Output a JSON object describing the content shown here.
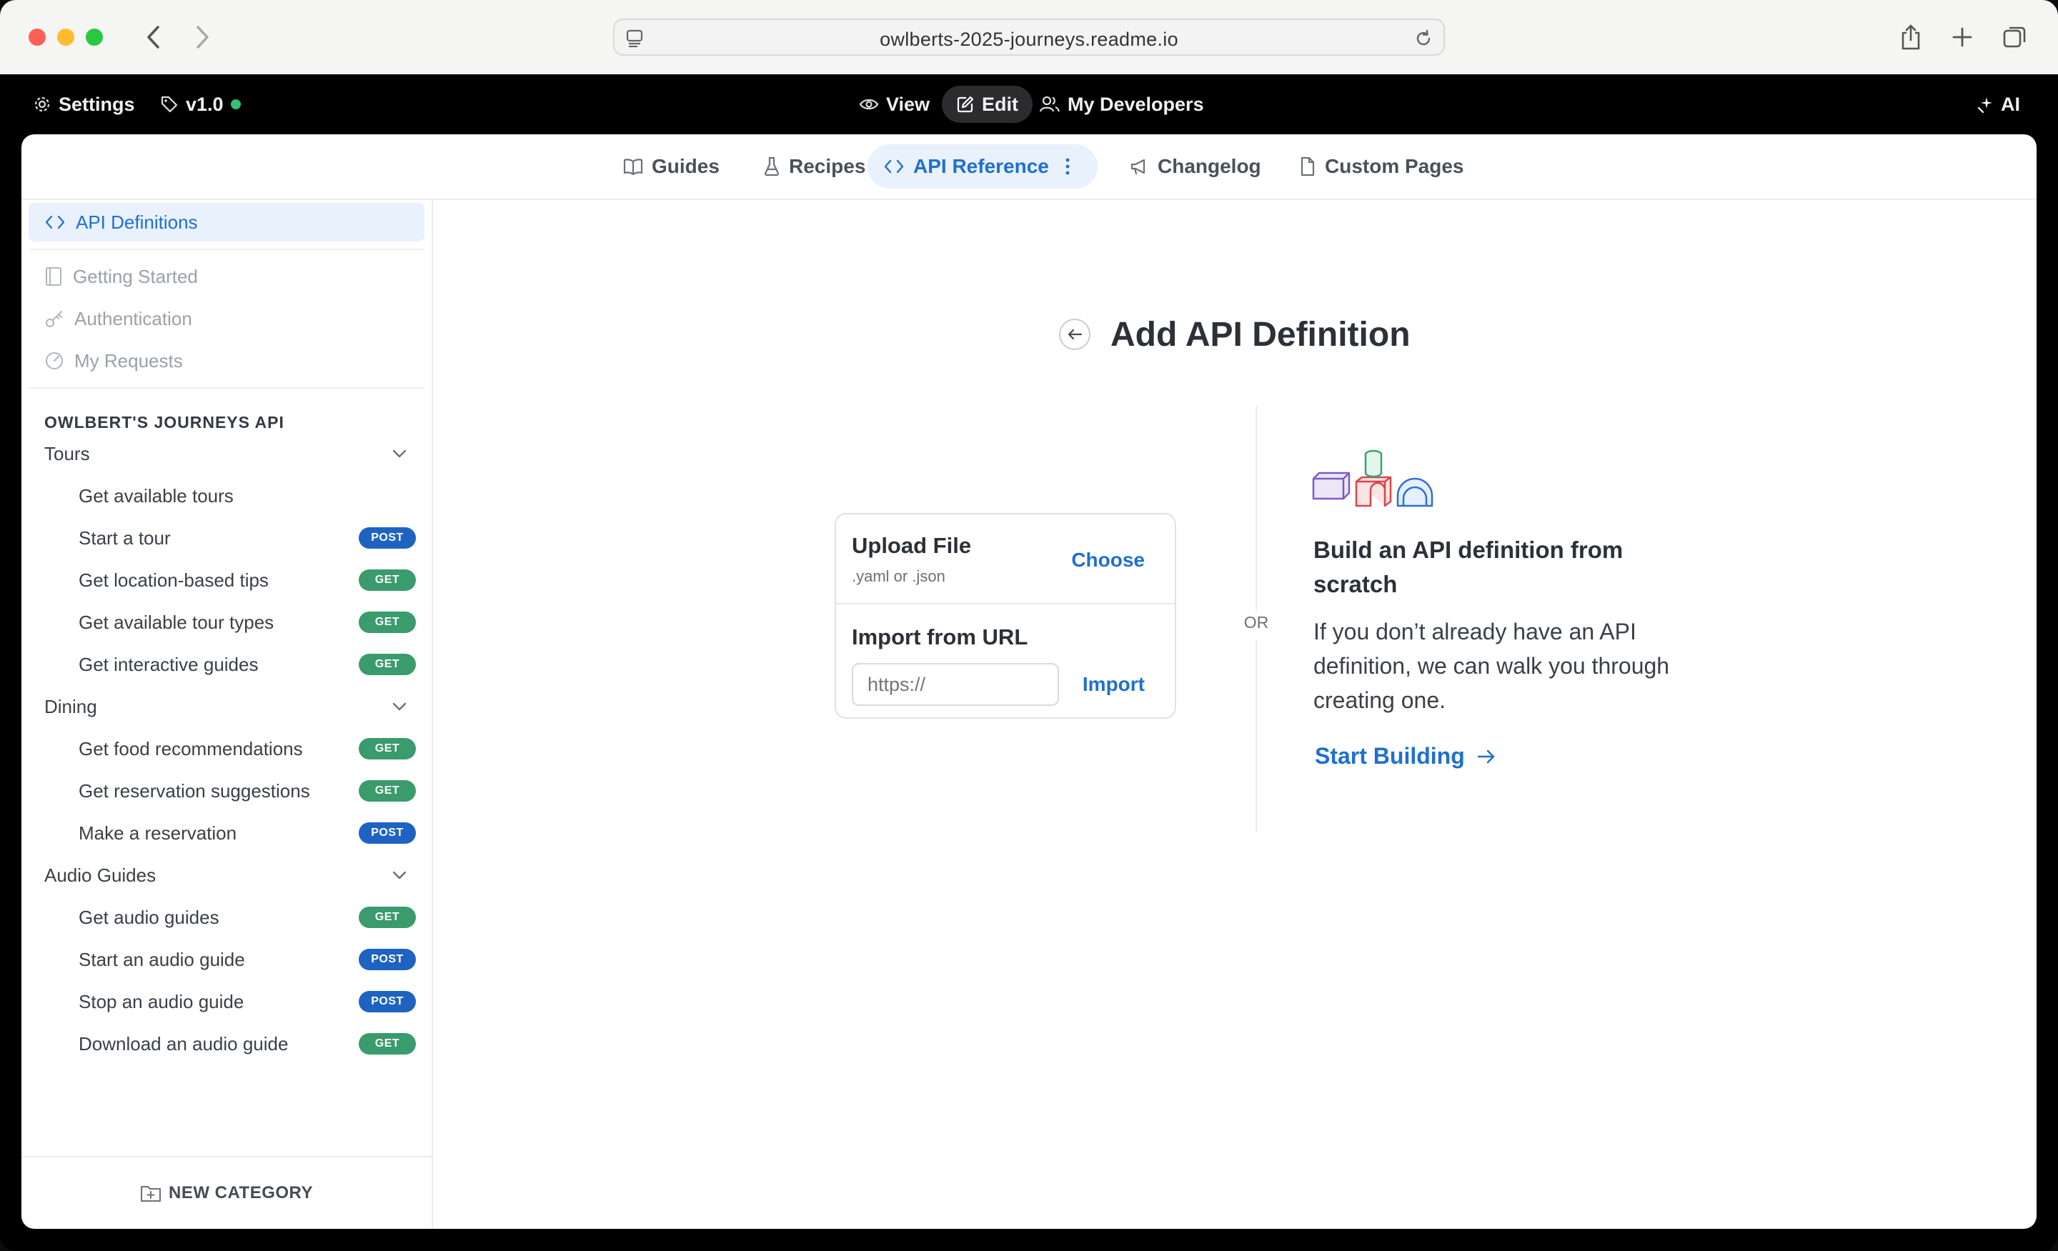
{
  "browser": {
    "url": "owlberts-2025-journeys.readme.io"
  },
  "appbar": {
    "settings_label": "Settings",
    "version_label": "v1.0",
    "view_label": "View",
    "edit_label": "Edit",
    "developers_label": "My Developers",
    "ai_label": "AI"
  },
  "tabs": [
    {
      "label": "Guides",
      "icon": "book-icon"
    },
    {
      "label": "Recipes",
      "icon": "flask-icon"
    },
    {
      "label": "API Reference",
      "icon": "code-icon",
      "active": true
    },
    {
      "label": "Changelog",
      "icon": "megaphone-icon"
    },
    {
      "label": "Custom Pages",
      "icon": "page-icon"
    }
  ],
  "sidebar": {
    "top_items": [
      {
        "label": "API Definitions",
        "icon": "code-icon",
        "active": true
      },
      {
        "label": "Getting Started",
        "icon": "book-icon"
      },
      {
        "label": "Authentication",
        "icon": "key-icon"
      },
      {
        "label": "My Requests",
        "icon": "gauge-icon"
      }
    ],
    "section_heading": "OWLBERT'S JOURNEYS API",
    "categories": [
      {
        "name": "Tours",
        "items": [
          {
            "label": "Get available tours",
            "method": ""
          },
          {
            "label": "Start a tour",
            "method": "POST"
          },
          {
            "label": "Get location-based tips",
            "method": "GET"
          },
          {
            "label": "Get available tour types",
            "method": "GET"
          },
          {
            "label": "Get interactive guides",
            "method": "GET"
          }
        ]
      },
      {
        "name": "Dining",
        "items": [
          {
            "label": "Get food recommendations",
            "method": "GET"
          },
          {
            "label": "Get reservation suggestions",
            "method": "GET"
          },
          {
            "label": "Make a reservation",
            "method": "POST"
          }
        ]
      },
      {
        "name": "Audio Guides",
        "items": [
          {
            "label": "Get audio guides",
            "method": "GET"
          },
          {
            "label": "Start an audio guide",
            "method": "POST"
          },
          {
            "label": "Stop an audio guide",
            "method": "POST"
          },
          {
            "label": "Download an audio guide",
            "method": "GET"
          }
        ]
      }
    ],
    "new_category_label": "NEW CATEGORY"
  },
  "main": {
    "title": "Add API Definition",
    "upload": {
      "title": "Upload File",
      "subtitle": ".yaml or .json",
      "choose_label": "Choose"
    },
    "import": {
      "title": "Import from URL",
      "placeholder": "https://",
      "button_label": "Import"
    },
    "or_label": "OR",
    "build": {
      "title": "Build an API definition from scratch",
      "description": "If you don’t already have an API definition, we can walk you through creating one.",
      "button_label": "Start Building"
    }
  },
  "colors": {
    "accent": "#1f6fd1",
    "get_badge": "#3a9b6c",
    "post_badge": "#1f63c2",
    "status_dot": "#33c173"
  }
}
